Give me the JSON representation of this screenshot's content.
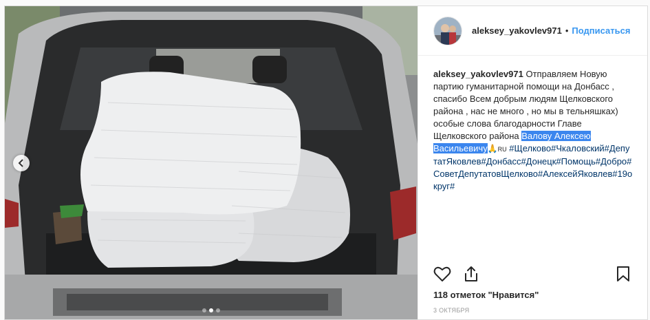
{
  "post": {
    "username": "aleksey_yakovlev971",
    "separator": "•",
    "follow_label": "Подписаться",
    "caption": {
      "username": "aleksey_yakovlev971",
      "text": "Отправляем Новую партию гуманитарной помощи на Донбасс , спасибо Всем добрым людям Щелковского района , нас не много , но мы в тельняшках) особые слова благодарности Главе Щелковского района",
      "highlighted": "Валову Алексею Васильевичу",
      "emoji": "🙏",
      "emoji_suffix": "RU",
      "hashtags": "#Щелково#Чкаловский#ДепутатЯковлев#Донбасс#Донецк#Помощь#Добро#СоветДепутатовЩелково#АлексейЯковлев#19округ#"
    },
    "likes": "118 отметок \"Нравится\"",
    "date": "3 ОКТЯБРЯ",
    "carousel": {
      "count": 3,
      "active_index": 1
    }
  },
  "icons": {
    "like": "heart-icon",
    "share": "share-icon",
    "save": "bookmark-icon",
    "prev": "chevron-left-icon"
  },
  "colors": {
    "link_blue": "#3897f0",
    "hashtag": "#003569",
    "selection": "#3b86ee"
  }
}
